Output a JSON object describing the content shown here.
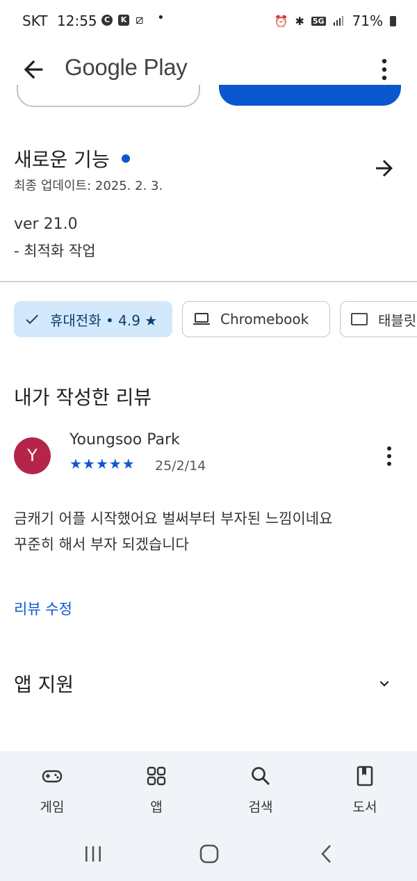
{
  "status_bar": {
    "carrier": "SKT",
    "time": "12:55",
    "network": "5G",
    "battery": "71%"
  },
  "app_bar": {
    "title": "Google Play",
    "back_icon": "arrow-back-icon",
    "more_icon": "more-vert-icon"
  },
  "whats_new": {
    "title": "새로운 기능",
    "last_updated": "최종 업데이트: 2025. 2. 3.",
    "version": "ver 21.0",
    "note": "- 최적화 작업",
    "arrow_icon": "arrow-forward-icon"
  },
  "device_chips": [
    {
      "label": "휴대전화 • 4.9 ★",
      "selected": true,
      "icon": "check-icon"
    },
    {
      "label": "Chromebook",
      "selected": false,
      "icon": "laptop-icon"
    },
    {
      "label": "태블릿",
      "selected": false,
      "icon": "tablet-icon"
    }
  ],
  "my_review": {
    "heading": "내가 작성한 리뷰",
    "avatar_letter": "Y",
    "avatar_color": "#b5254a",
    "author": "Youngsoo Park",
    "stars_text": "★★★★★",
    "rating": 5,
    "date": "25/2/14",
    "body_line1": "금캐기 어플 시작했어요 벌써부터 부자된 느낌이네요",
    "body_line2": "꾸준히 해서 부자 되겠습니다",
    "edit_label": "리뷰 수정"
  },
  "app_support": {
    "title": "앱 지원",
    "chevron_icon": "chevron-down-icon"
  },
  "bottom_nav": [
    {
      "label": "게임",
      "icon": "gamepad-icon"
    },
    {
      "label": "앱",
      "icon": "apps-grid-icon"
    },
    {
      "label": "검색",
      "icon": "search-icon"
    },
    {
      "label": "도서",
      "icon": "book-icon"
    }
  ],
  "colors": {
    "accent": "#0b57d0",
    "chip_selected_bg": "#d3e8fb",
    "nav_bg": "#f0f4f9"
  }
}
